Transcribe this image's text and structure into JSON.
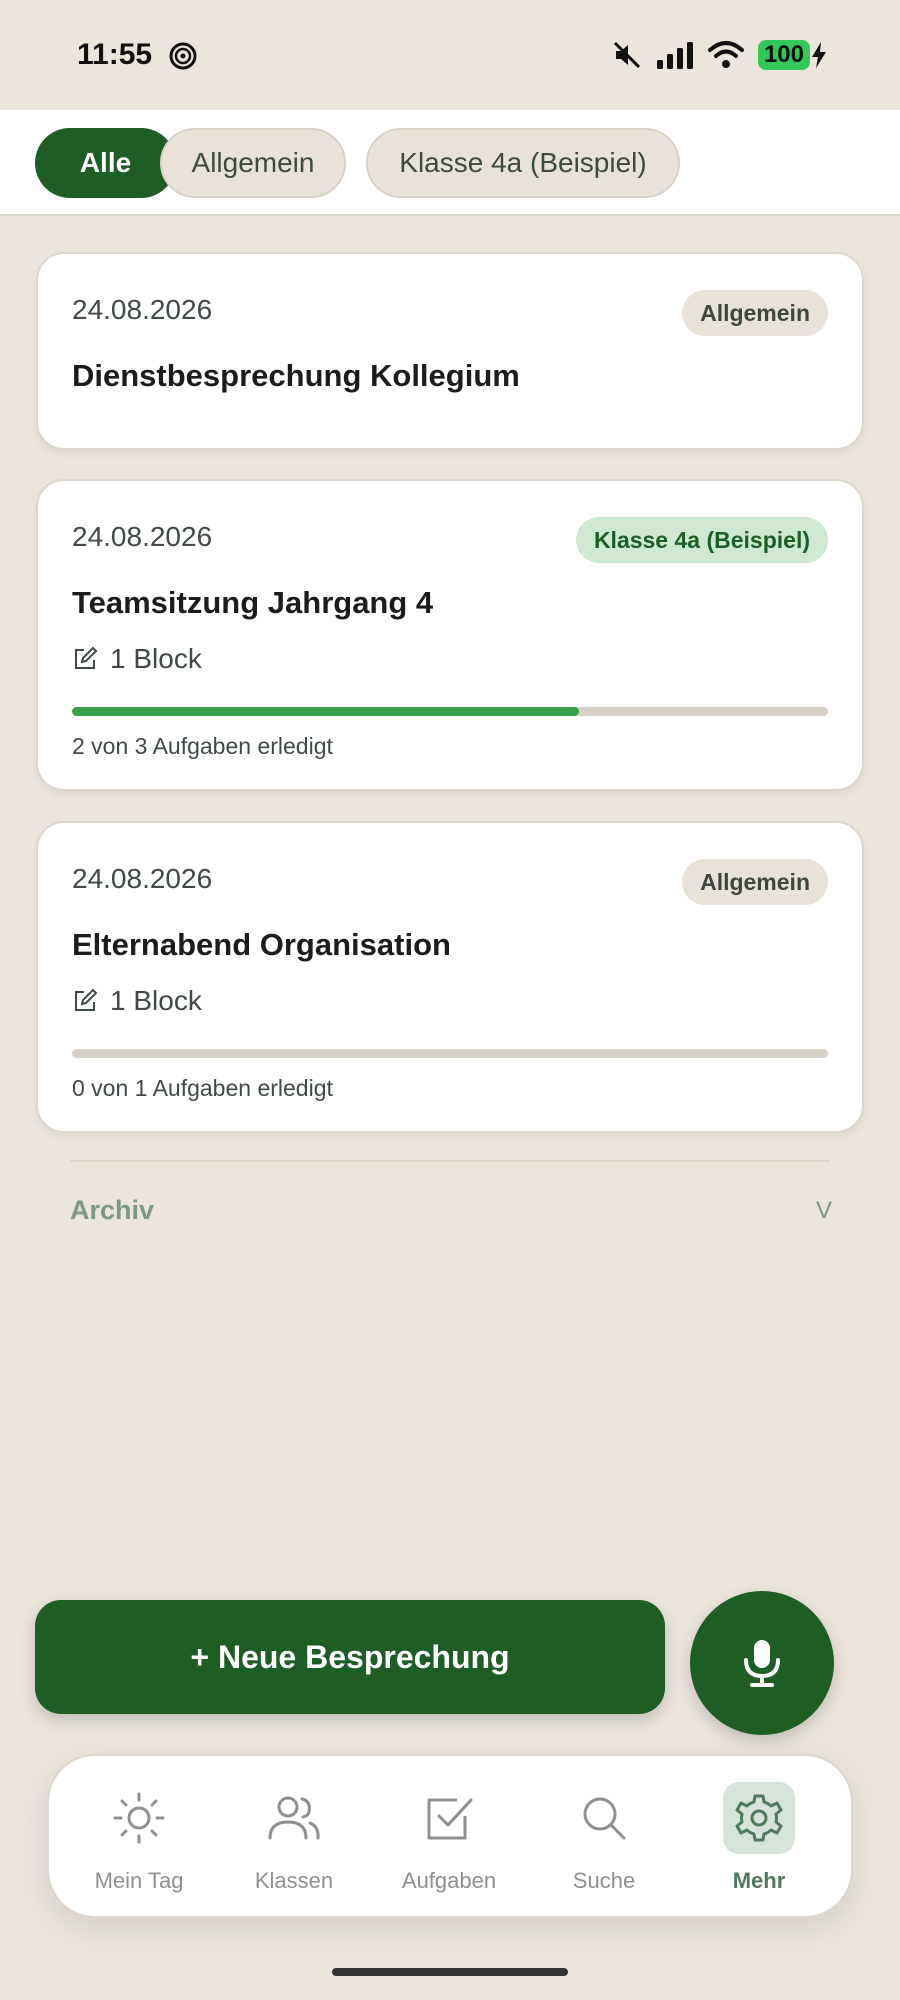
{
  "status_bar": {
    "time": "11:55",
    "battery": "100",
    "icons": [
      "focus-icon",
      "mute-icon",
      "signal-icon",
      "wifi-icon",
      "battery-icon",
      "charging-icon"
    ]
  },
  "filters": [
    {
      "label": "Alle",
      "active": true
    },
    {
      "label": "Allgemein",
      "active": false
    },
    {
      "label": "Klasse 4a (Beispiel)",
      "active": false
    }
  ],
  "meetings": [
    {
      "date": "24.08.2026",
      "badge": "Allgemein",
      "title": "Dienstbesprechung Kollegium"
    },
    {
      "date": "24.08.2026",
      "badge": "Klasse 4a (Beispiel)",
      "title": "Teamsitzung Jahrgang 4",
      "blocks": "1 Block",
      "progress_fraction": 0.67,
      "progress_text": "2 von 3 Aufgaben erledigt"
    },
    {
      "date": "24.08.2026",
      "badge": "Allgemein",
      "title": "Elternabend Organisation",
      "blocks": "1 Block",
      "progress_fraction": 0,
      "progress_text": "0 von 1 Aufgaben erledigt"
    }
  ],
  "archive": {
    "label": "Archiv",
    "chevron": "V"
  },
  "actions": {
    "new_meeting": "+ Neue Besprechung",
    "mic_icon": "microphone-icon"
  },
  "nav": [
    {
      "label": "Mein Tag",
      "icon": "sun-icon",
      "active": false
    },
    {
      "label": "Klassen",
      "icon": "users-icon",
      "active": false
    },
    {
      "label": "Aufgaben",
      "icon": "checkbox-icon",
      "active": false
    },
    {
      "label": "Suche",
      "icon": "search-icon",
      "active": false
    },
    {
      "label": "Mehr",
      "icon": "gear-icon",
      "active": true
    }
  ],
  "colors": {
    "background": "#EBE5DC",
    "primary_green": "#1E5E24",
    "progress_green": "#3AA14B",
    "class_badge_bg": "#CFE9D1",
    "general_badge_bg": "#E9E2D8"
  }
}
